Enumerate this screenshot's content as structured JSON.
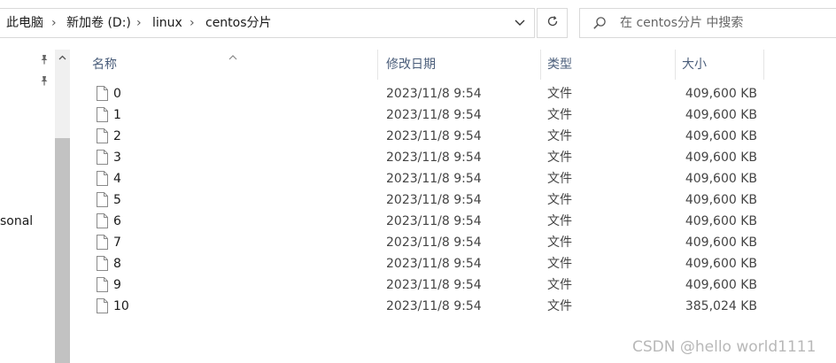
{
  "address_bar": {
    "breadcrumbs": [
      "此电脑",
      "新加卷 (D:)",
      "linux",
      "centos分片"
    ]
  },
  "search": {
    "placeholder": "在 centos分片 中搜索"
  },
  "nav": {
    "partial_label": "sonal"
  },
  "columns": {
    "name": "名称",
    "date": "修改日期",
    "type": "类型",
    "size": "大小"
  },
  "files": [
    {
      "name": "0",
      "date": "2023/11/8 9:54",
      "type": "文件",
      "size": "409,600 KB"
    },
    {
      "name": "1",
      "date": "2023/11/8 9:54",
      "type": "文件",
      "size": "409,600 KB"
    },
    {
      "name": "2",
      "date": "2023/11/8 9:54",
      "type": "文件",
      "size": "409,600 KB"
    },
    {
      "name": "3",
      "date": "2023/11/8 9:54",
      "type": "文件",
      "size": "409,600 KB"
    },
    {
      "name": "4",
      "date": "2023/11/8 9:54",
      "type": "文件",
      "size": "409,600 KB"
    },
    {
      "name": "5",
      "date": "2023/11/8 9:54",
      "type": "文件",
      "size": "409,600 KB"
    },
    {
      "name": "6",
      "date": "2023/11/8 9:54",
      "type": "文件",
      "size": "409,600 KB"
    },
    {
      "name": "7",
      "date": "2023/11/8 9:54",
      "type": "文件",
      "size": "409,600 KB"
    },
    {
      "name": "8",
      "date": "2023/11/8 9:54",
      "type": "文件",
      "size": "409,600 KB"
    },
    {
      "name": "9",
      "date": "2023/11/8 9:54",
      "type": "文件",
      "size": "409,600 KB"
    },
    {
      "name": "10",
      "date": "2023/11/8 9:54",
      "type": "文件",
      "size": "385,024 KB"
    }
  ],
  "watermark": "CSDN @hello world1111",
  "icons": {
    "breadcrumb_separator": "chevron-right-icon",
    "address_dropdown": "chevron-down-icon",
    "refresh": "refresh-icon",
    "search": "search-icon",
    "pin": "pin-icon",
    "file": "file-icon",
    "sort": "sort-up-icon"
  },
  "colors": {
    "header_text": "#4a5d7a",
    "border": "#d9d9d9",
    "scrollbar_thumb": "#c2c2c2"
  }
}
